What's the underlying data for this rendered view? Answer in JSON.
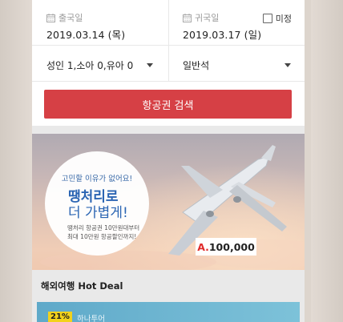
{
  "departure": {
    "label": "출국일",
    "date": "2019.03.14 (목)"
  },
  "return": {
    "label": "귀국일",
    "date": "2019.03.17 (일)",
    "undecided_label": "미정"
  },
  "passengers": {
    "value": "성인 1,소아 0,유아 0"
  },
  "cabin_class": {
    "value": "일반석"
  },
  "search_button": {
    "label": "항공권 검색"
  },
  "banner": {
    "tagline": "고민할 이유가 없어요!",
    "headline1": "땡처리로",
    "headline2": "더 가볍게!",
    "sub1": "땡처리 항공권 10만원대부터",
    "sub2": "최대 10만원 항공할인까지!",
    "price_prefix": "A.",
    "price": "100,000"
  },
  "hot_deal": {
    "title": "해외여행 Hot Deal",
    "items": [
      {
        "discount": "21%",
        "vendor": "하나투어"
      }
    ]
  },
  "colors": {
    "accent": "#d64045",
    "brand_blue": "#2b65b3",
    "badge": "#f3d21c"
  }
}
